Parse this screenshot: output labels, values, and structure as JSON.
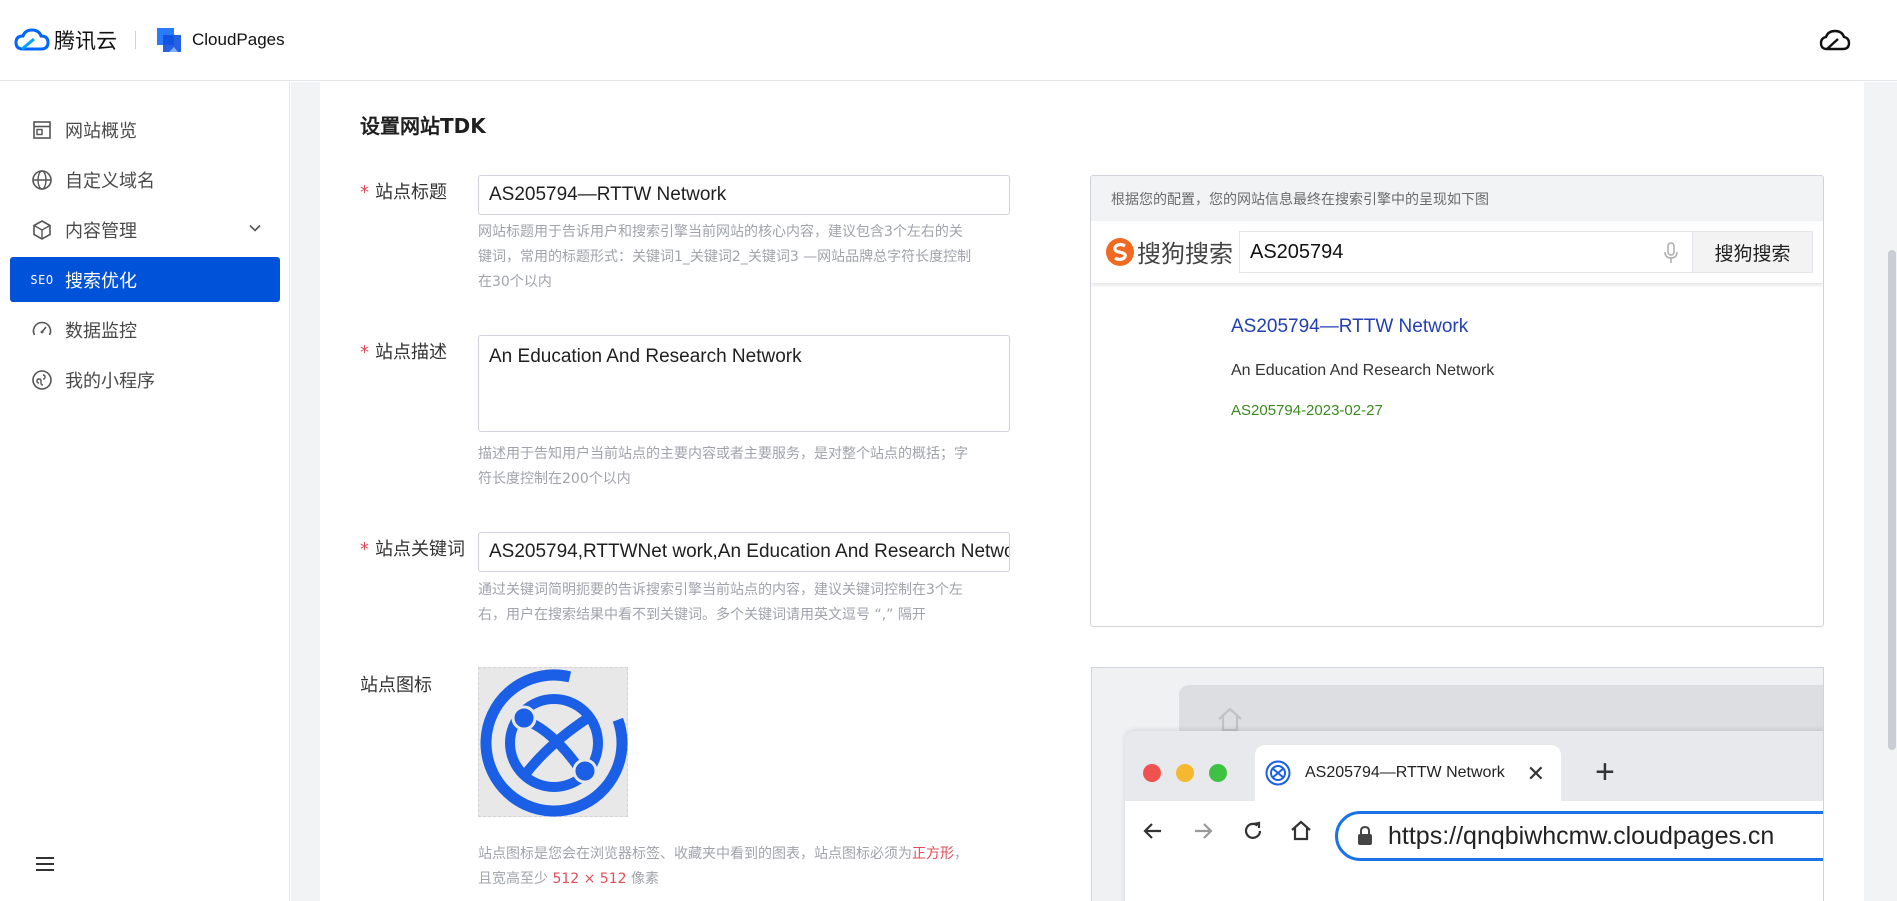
{
  "header": {
    "brand": "腾讯云",
    "product": "CloudPages"
  },
  "sidebar": {
    "items": [
      {
        "label": "网站概览",
        "icon": "browser-window-icon"
      },
      {
        "label": "自定义域名",
        "icon": "globe-icon"
      },
      {
        "label": "内容管理",
        "icon": "cube-icon"
      },
      {
        "label": "搜索优化",
        "icon": "seo-icon",
        "icon_text": "SEO"
      },
      {
        "label": "数据监控",
        "icon": "gauge-icon"
      },
      {
        "label": "我的小程序",
        "icon": "mini-program-icon"
      }
    ]
  },
  "form": {
    "section_title": "设置网站TDK",
    "title_label": "站点标题",
    "title_value": "AS205794—RTTW Network",
    "title_help": [
      "网站标题用于告诉用户和搜索引擎当前网站的核心内容，建议包含3个左右的关",
      "键词，常用的标题形式：关键词1_关键词2_关键词3 —网站品牌总字符长度控制",
      "在30个以内"
    ],
    "desc_label": "站点描述",
    "desc_value": "An Education And Research Network",
    "desc_help": [
      "描述用于告知用户当前站点的主要内容或者主要服务，是对整个站点的概括；字",
      "符长度控制在200个以内"
    ],
    "keywords_label": "站点关键词",
    "keywords_value": "AS205794,RTTWNet work,An Education And Research Netwo",
    "keywords_help": [
      "通过关键词简明扼要的告诉搜索引擎当前站点的内容，建议关键词控制在3个左",
      "右，用户在搜索结果中看不到关键词。多个关键词请用英文逗号 “,” 隔开"
    ],
    "favicon_label": "站点图标",
    "favicon_help_1a": "站点图标是您会在浏览器标签、收藏夹中看到的图表，站点图标必须为",
    "favicon_help_1b": "正方形",
    "favicon_help_1c": "，",
    "favicon_help_2a": "且宽高至少 ",
    "favicon_help_2b": "512 × 512",
    "favicon_help_2c": " 像素"
  },
  "search_preview": {
    "note": "根据您的配置，您的网站信息最终在搜索引擎中的呈现如下图",
    "engine_name": "搜狗搜索",
    "query": "AS205794",
    "button": "搜狗搜索",
    "result_title": "AS205794—RTTW Network",
    "result_desc": "An Education And Research Network",
    "result_url": "AS205794-2023-02-27"
  },
  "browser_preview": {
    "tab_title": "AS205794—RTTW Network",
    "tab_close": "✕",
    "new_tab": "+",
    "url": "https://qnqbiwhcmw.cloudpages.cn"
  },
  "colors": {
    "accent": "#0052d9",
    "required": "#e34d59",
    "link": "#2440b3",
    "url_green": "#3a8a1f"
  }
}
